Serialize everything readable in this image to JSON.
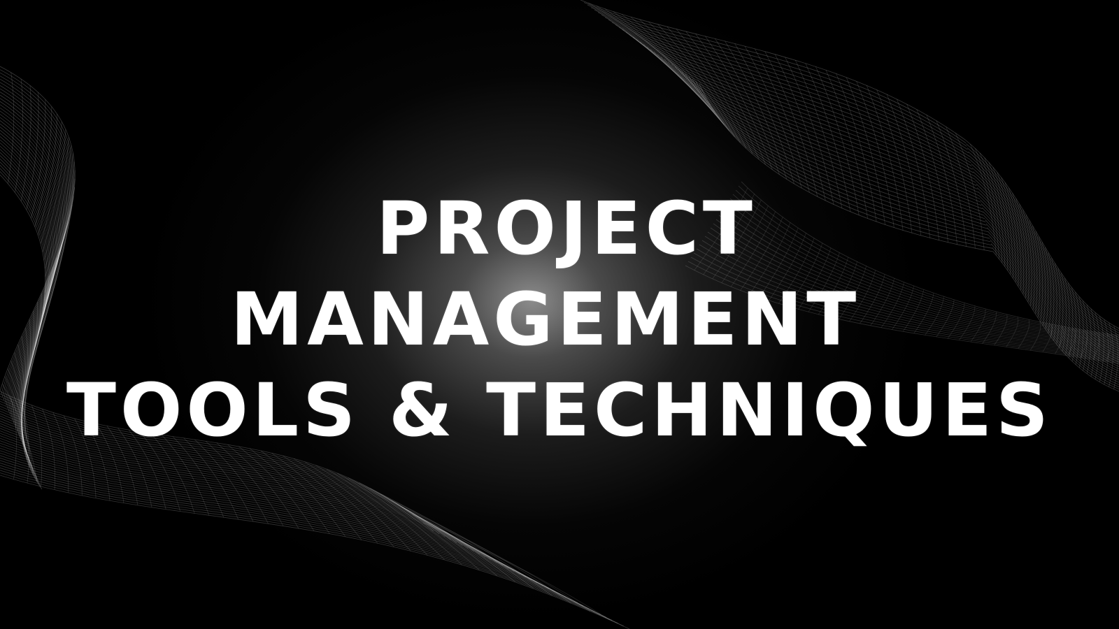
{
  "slide": {
    "title_lines": [
      "Project",
      "Management",
      "Tools & Techniques"
    ]
  },
  "colors": {
    "background": "#000000",
    "glow": "#8c8c8c",
    "text": "#ffffff",
    "wave_lines": "#ffffff"
  },
  "decorations": {
    "left_wave": "wave-mesh-graphic",
    "right_wave": "wave-mesh-graphic"
  }
}
